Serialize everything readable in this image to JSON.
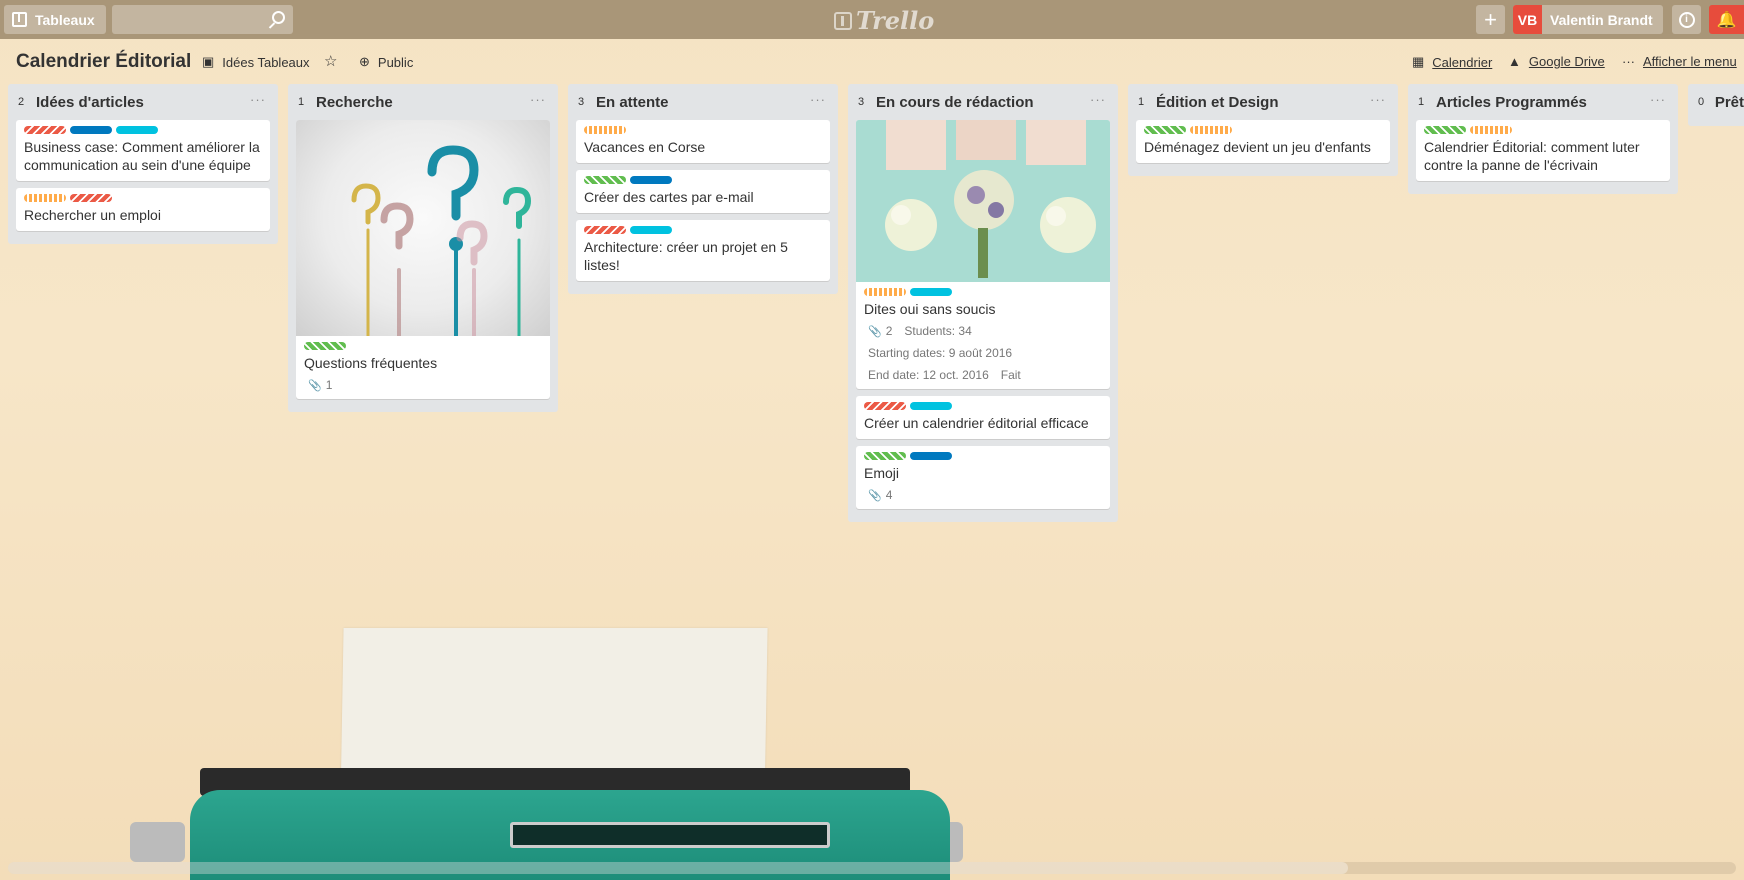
{
  "header": {
    "boards_label": "Tableaux",
    "search_placeholder": "",
    "logo_text": "Trello",
    "add_symbol": "+",
    "user_initials": "VB",
    "user_name": "Valentin Brandt",
    "info_symbol": "i",
    "notification_symbol": "🔔"
  },
  "board": {
    "title": "Calendrier Éditorial",
    "team_label": "Idées Tableaux",
    "visibility_label": "Public",
    "calendar_label": "Calendrier",
    "drive_label": "Google Drive",
    "menu_label": "Afficher le menu"
  },
  "colors": {
    "red": "#eb5a46",
    "blue": "#0079bf",
    "sky": "#00c2e0",
    "green": "#61bd4f",
    "orange": "#ffab4a"
  },
  "lists": [
    {
      "count": "2",
      "title": "Idées d'articles",
      "cards": [
        {
          "labels": [
            "red",
            "blue",
            "sky"
          ],
          "title": "Business case: Comment améliorer la communication au sein d'une équipe"
        },
        {
          "labels": [
            "orange",
            "red"
          ],
          "title": "Rechercher un emploi"
        }
      ]
    },
    {
      "count": "1",
      "title": "Recherche",
      "cards": [
        {
          "labels": [
            "green"
          ],
          "title": "Questions fréquentes",
          "attachments": "1",
          "cover": "question-marks"
        }
      ]
    },
    {
      "count": "3",
      "title": "En attente",
      "cards": [
        {
          "labels": [
            "orange"
          ],
          "title": "Vacances en Corse"
        },
        {
          "labels": [
            "green",
            "blue"
          ],
          "title": "Créer des cartes par e-mail"
        },
        {
          "labels": [
            "red",
            "sky"
          ],
          "title": "Architecture: créer un projet en 5 listes!"
        }
      ]
    },
    {
      "count": "3",
      "title": "En cours de rédaction",
      "cards": [
        {
          "labels": [
            "orange",
            "sky"
          ],
          "title": "Dites oui sans soucis",
          "attachments": "2",
          "students": "Students: 34",
          "start": "Starting dates: 9 août 2016",
          "end": "End date: 12 oct. 2016",
          "status": "Fait",
          "cover": "wedding-bouquets"
        },
        {
          "labels": [
            "red",
            "sky"
          ],
          "title": "Créer un calendrier éditorial efficace"
        },
        {
          "labels": [
            "green",
            "blue"
          ],
          "title": "Emoji",
          "attachments": "4"
        }
      ]
    },
    {
      "count": "1",
      "title": "Édition et Design",
      "cards": [
        {
          "labels": [
            "green",
            "orange"
          ],
          "title": "Déménagez devient un jeu d'enfants"
        }
      ]
    },
    {
      "count": "1",
      "title": "Articles Programmés",
      "cards": [
        {
          "labels": [
            "green",
            "orange"
          ],
          "title": "Calendrier Éditorial: comment luter contre la panne de l'écrivain"
        }
      ]
    },
    {
      "count": "0",
      "title": "Prêt",
      "cards": []
    }
  ]
}
